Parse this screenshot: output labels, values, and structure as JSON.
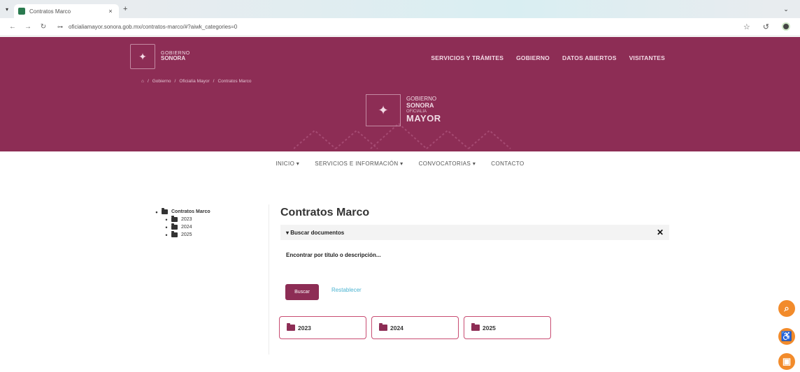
{
  "browser": {
    "tab_title": "Contratos Marco",
    "tab_close": "×",
    "new_tab": "+",
    "menu": "⌄",
    "url": "oficialiamayor.sonora.gob.mx/contratos-marco/#?aiwk_categories=0"
  },
  "header": {
    "logo_line1": "GOBIERNO",
    "logo_line2": "SONORA",
    "nav": [
      "SERVICIOS Y TRÁMITES",
      "GOBIERNO",
      "DATOS ABIERTOS",
      "VISITANTES"
    ],
    "breadcrumb": [
      "⌂",
      "/",
      "Gobierno",
      "/",
      "Oficialía Mayor",
      "/",
      "Contratos Marco"
    ],
    "center_logo": {
      "line1": "GOBIERNO",
      "line2": "SONORA",
      "line3": "OFICIALÍA",
      "line4": "MAYOR"
    },
    "bg_color": "#8d2d55"
  },
  "sitenav": {
    "items": [
      "INICIO ▾",
      "SERVICIOS E INFORMACIÓN ▾",
      "CONVOCATORIAS ▾",
      "CONTACTO"
    ]
  },
  "tree": {
    "root": "Contratos Marco",
    "children": [
      "2023",
      "2024",
      "2025"
    ]
  },
  "main": {
    "title": "Contratos Marco",
    "search_toggle": "Buscar documentos",
    "search_close": "✕",
    "search_label": "Encontrar por título o descripción...",
    "buscar_button": "Buscar",
    "reset_link": "Restablecer",
    "folders": [
      "2023",
      "2024",
      "2025"
    ]
  },
  "floating": {
    "search_icon": "search-icon",
    "accessibility_icon": "accessibility-icon",
    "chat_icon": "chat-icon",
    "accent": "#f28b2b"
  }
}
